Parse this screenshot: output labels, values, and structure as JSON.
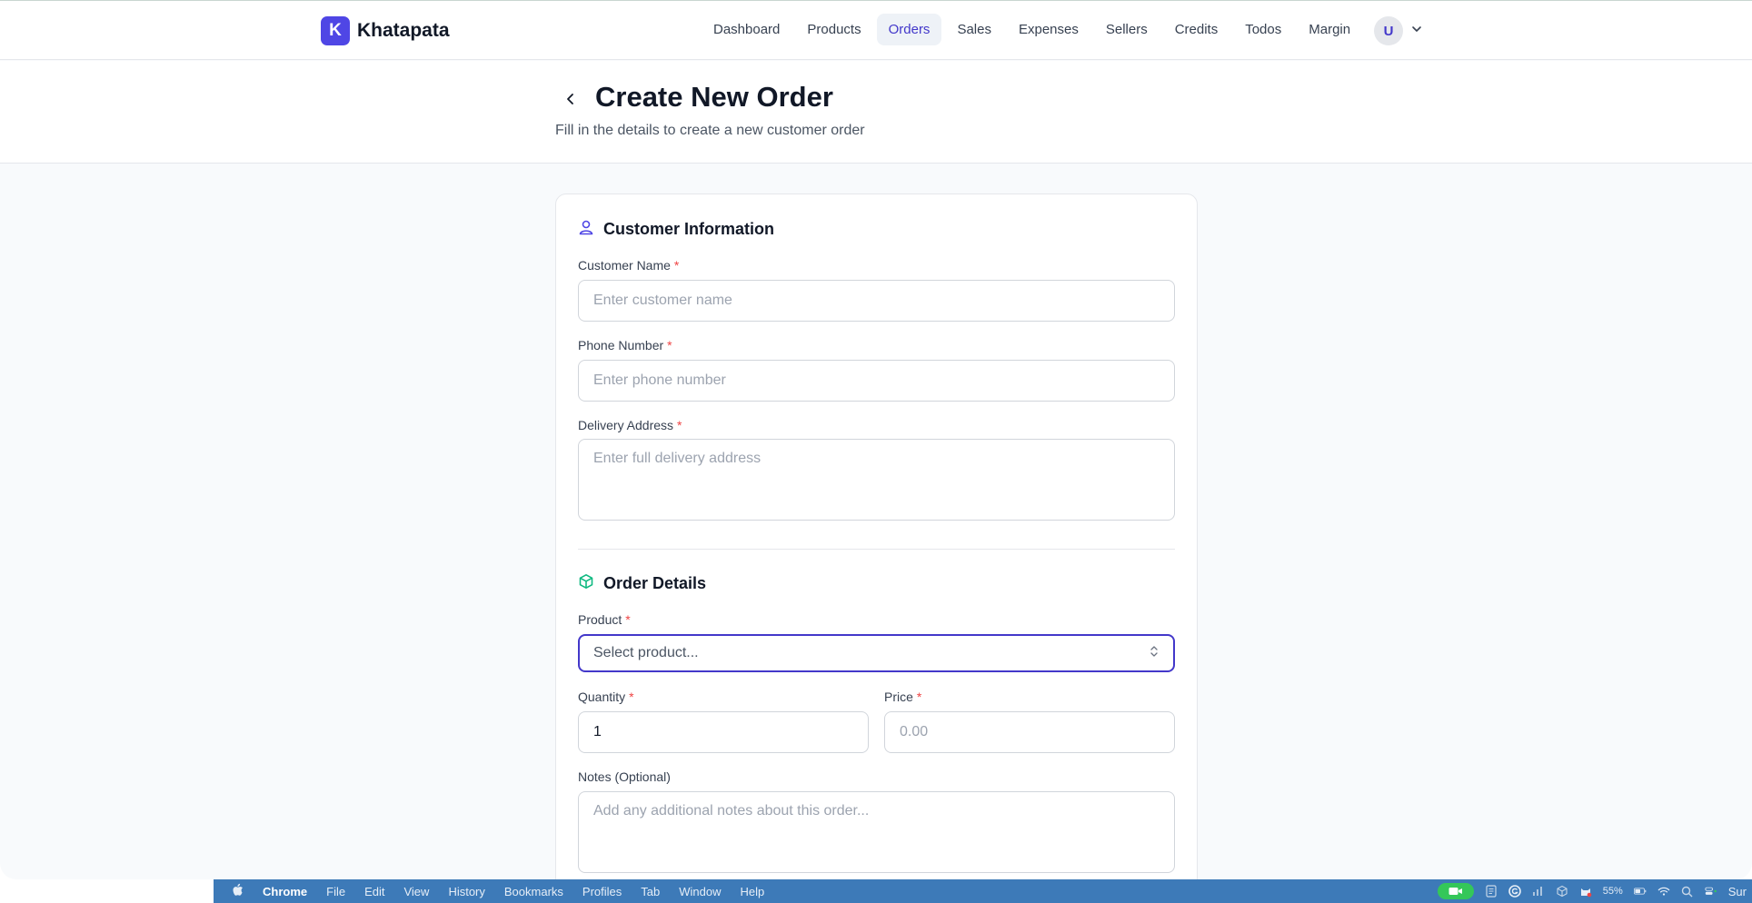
{
  "header": {
    "brand_letter": "K",
    "brand_name": "Khatapata",
    "nav": [
      {
        "label": "Dashboard",
        "active": false
      },
      {
        "label": "Products",
        "active": false
      },
      {
        "label": "Orders",
        "active": true
      },
      {
        "label": "Sales",
        "active": false
      },
      {
        "label": "Expenses",
        "active": false
      },
      {
        "label": "Sellers",
        "active": false
      },
      {
        "label": "Credits",
        "active": false
      },
      {
        "label": "Todos",
        "active": false
      },
      {
        "label": "Margin",
        "active": false
      }
    ],
    "user_initial": "U"
  },
  "page": {
    "title": "Create New Order",
    "subtitle": "Fill in the details to create a new customer order"
  },
  "customer_section": {
    "title": "Customer Information",
    "icon": "user-icon",
    "name_label": "Customer Name",
    "name_placeholder": "Enter customer name",
    "phone_label": "Phone Number",
    "phone_placeholder": "Enter phone number",
    "address_label": "Delivery Address",
    "address_placeholder": "Enter full delivery address",
    "required_mark": "*"
  },
  "order_section": {
    "title": "Order Details",
    "icon": "package-icon",
    "product_label": "Product",
    "product_placeholder": "Select product...",
    "quantity_label": "Quantity",
    "quantity_value": "1",
    "price_label": "Price",
    "price_placeholder": "0.00",
    "notes_label": "Notes (Optional)",
    "notes_placeholder": "Add any additional notes about this order..."
  },
  "menubar": {
    "app": "Chrome",
    "items": [
      "File",
      "Edit",
      "View",
      "History",
      "Bookmarks",
      "Profiles",
      "Tab",
      "Window",
      "Help"
    ],
    "battery": "55%",
    "clock_fragment": "Sur"
  },
  "colors": {
    "accent": "#4f46e5",
    "active_nav_text": "#4338ca",
    "required": "#ef4444",
    "order_icon": "#10b981",
    "menubar_bg": "#3d7ab8"
  }
}
